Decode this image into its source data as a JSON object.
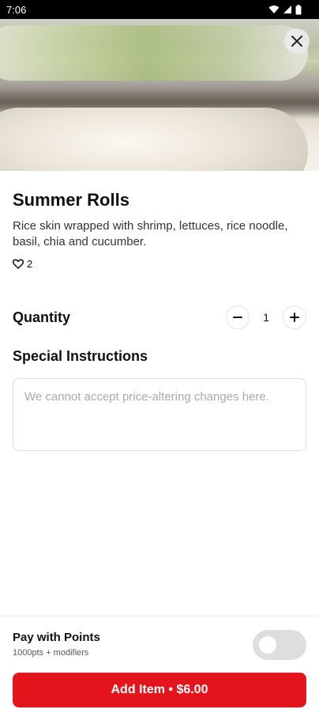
{
  "status_bar": {
    "time": "7:06"
  },
  "item": {
    "title": "Summer Rolls",
    "description": "Rice skin wrapped with shrimp, lettuces, rice noodle, basil, chia and cucumber.",
    "likes": "2"
  },
  "quantity": {
    "label": "Quantity",
    "value": "1"
  },
  "special_instructions": {
    "label": "Special Instructions",
    "placeholder": "We cannot accept price-altering changes here."
  },
  "points": {
    "label": "Pay with Points",
    "sublabel": "1000pts + modifiers",
    "enabled": false
  },
  "add_button": {
    "label": "Add Item • $6.00"
  },
  "colors": {
    "accent": "#e3141b",
    "toggle_off": "#dedede"
  },
  "icons": [
    "wifi-icon",
    "signal-icon",
    "battery-icon",
    "close-icon",
    "heart-icon",
    "minus-icon",
    "plus-icon"
  ]
}
